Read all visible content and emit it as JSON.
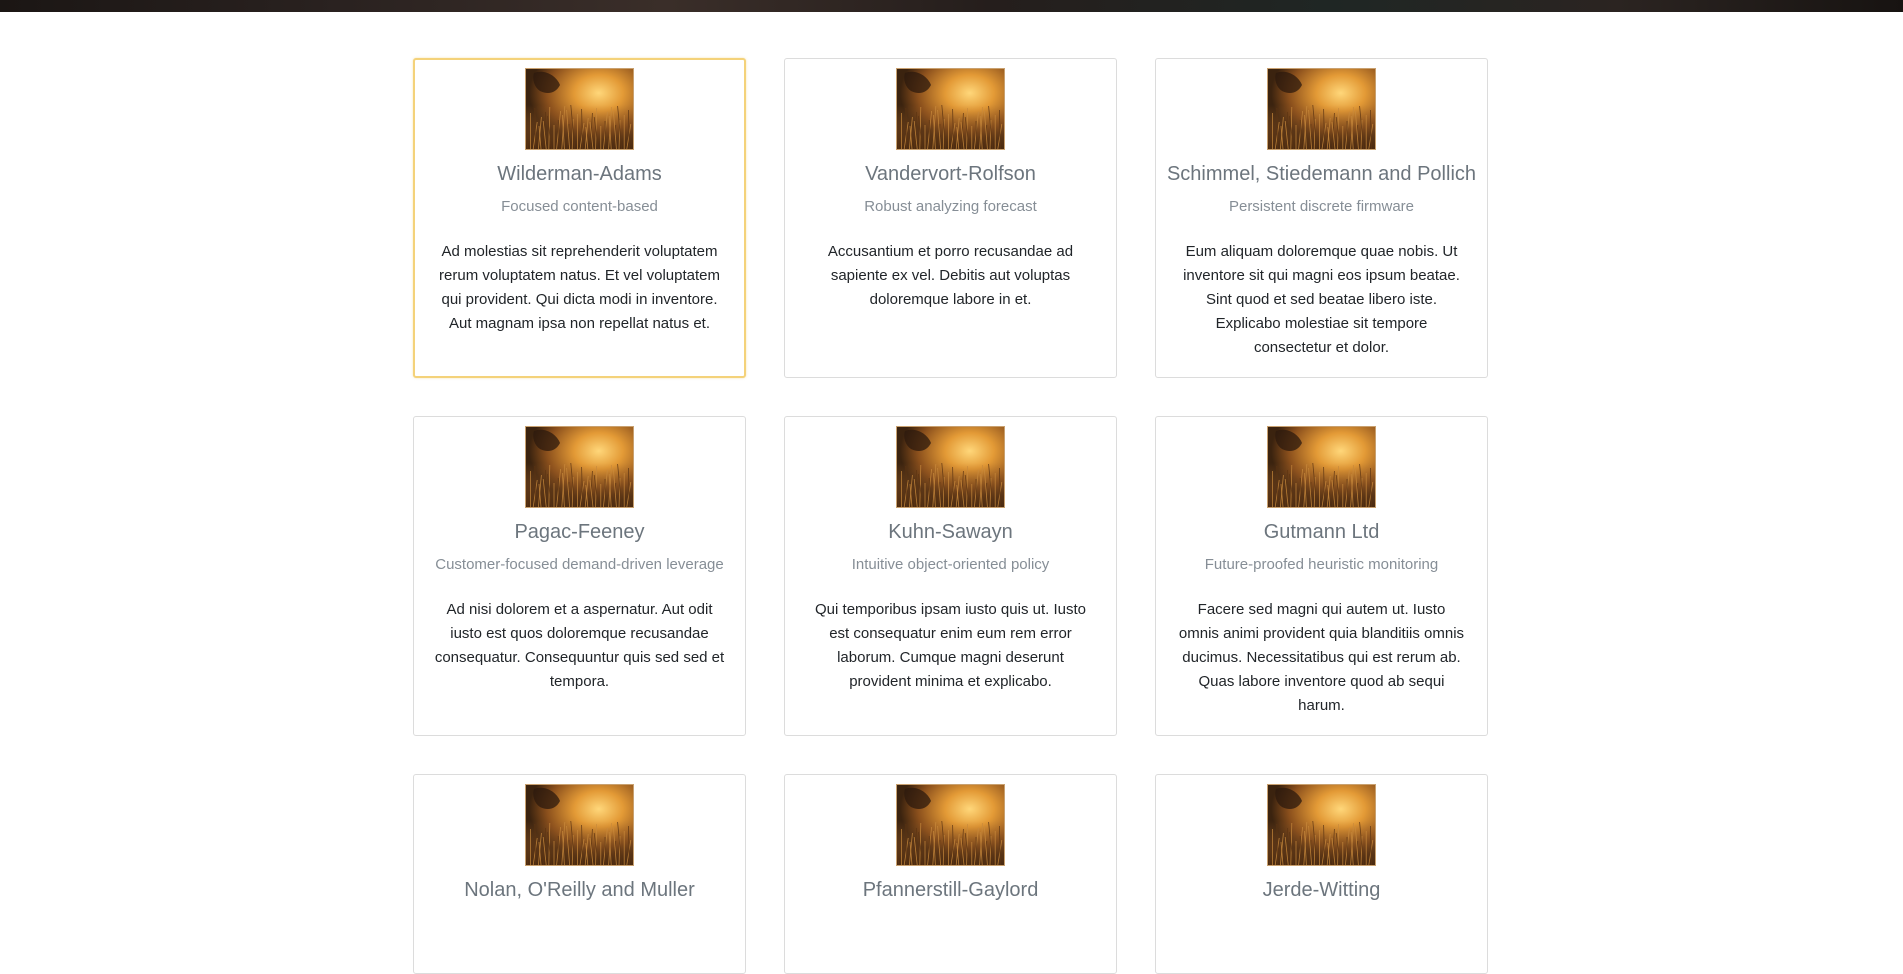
{
  "cards": [
    {
      "title": "Wilderman-Adams",
      "subtitle": "Focused content-based",
      "text": "Ad molestias sit reprehenderit voluptatem rerum voluptatem natus. Et vel voluptatem qui provident. Qui dicta modi in inventore. Aut magnam ipsa non repellat natus et."
    },
    {
      "title": "Vandervort-Rolfson",
      "subtitle": "Robust analyzing forecast",
      "text": "Accusantium et porro recusandae ad sapiente ex vel. Debitis aut voluptas doloremque labore in et."
    },
    {
      "title": "Schimmel, Stiedemann and Pollich",
      "subtitle": "Persistent discrete firmware",
      "text": "Eum aliquam doloremque quae nobis. Ut inventore sit qui magni eos ipsum beatae. Sint quod et sed beatae libero iste. Explicabo molestiae sit tempore consectetur et dolor."
    },
    {
      "title": "Pagac-Feeney",
      "subtitle": "Customer-focused demand-driven leverage",
      "text": "Ad nisi dolorem et a aspernatur. Aut odit iusto est quos doloremque recusandae consequatur. Consequuntur quis sed sed et tempora."
    },
    {
      "title": "Kuhn-Sawayn",
      "subtitle": "Intuitive object-oriented policy",
      "text": "Qui temporibus ipsam iusto quis ut. Iusto est consequatur enim eum rem error laborum. Cumque magni deserunt provident minima et explicabo."
    },
    {
      "title": "Gutmann Ltd",
      "subtitle": "Future-proofed heuristic monitoring",
      "text": "Facere sed magni qui autem ut. Iusto omnis animi provident quia blanditiis omnis ducimus. Necessitatibus qui est rerum ab. Quas labore inventore quod ab sequi harum."
    },
    {
      "title": "Nolan, O'Reilly and Muller",
      "subtitle": "",
      "text": ""
    },
    {
      "title": "Pfannerstill-Gaylord",
      "subtitle": "",
      "text": ""
    },
    {
      "title": "Jerde-Witting",
      "subtitle": "",
      "text": ""
    }
  ],
  "colors": {
    "active_border": "#f4d27a",
    "title": "#6c757d",
    "subtitle": "#868e96",
    "body_text": "#212529"
  },
  "image_icon": "sunset-grass-photo"
}
